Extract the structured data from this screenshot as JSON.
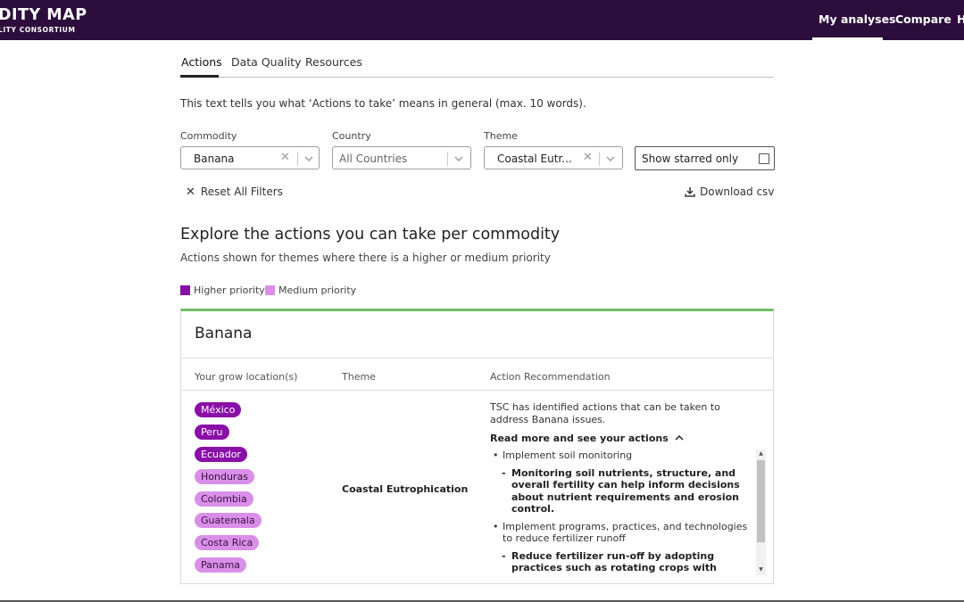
{
  "header": {
    "logo_title": "DITY MAP",
    "logo_subtitle": "LITY CONSORTIUM",
    "nav": [
      "My analyses",
      "Compare",
      "H"
    ],
    "active_nav": "My analyses"
  },
  "tabs": [
    "Actions",
    "Data Quality",
    "Resources"
  ],
  "active_tab": "Actions",
  "intro_text": "This text tells you what ‘Actions to take’ means in general (max. 10 words).",
  "filters": {
    "commodity": {
      "label": "Commodity",
      "value": "Banana"
    },
    "country": {
      "label": "Country",
      "placeholder": "All Countries"
    },
    "theme": {
      "label": "Theme",
      "value": "Coastal Eutr..."
    },
    "starred": {
      "label": "Show starred only",
      "checked": false
    },
    "reset_label": "Reset All Filters",
    "download_label": "Download csv"
  },
  "section": {
    "title": "Explore the actions you can take per commodity",
    "subtitle": "Actions shown for themes where there is a higher or medium priority"
  },
  "legend": {
    "higher": {
      "label": "Higher priority",
      "color": "#8a0fa8"
    },
    "medium": {
      "label": "Medium priority",
      "color": "#d98fe8"
    }
  },
  "card": {
    "title": "Banana",
    "accent_color": "#6fbf5f",
    "columns": [
      "Your grow location(s)",
      "Theme",
      "Action Recommendation"
    ],
    "locations": [
      {
        "name": "México",
        "priority": "higher"
      },
      {
        "name": "Peru",
        "priority": "higher"
      },
      {
        "name": "Ecuador",
        "priority": "higher"
      },
      {
        "name": "Honduras",
        "priority": "medium"
      },
      {
        "name": "Colombia",
        "priority": "medium"
      },
      {
        "name": "Guatemala",
        "priority": "medium"
      },
      {
        "name": "Costa Rica",
        "priority": "medium"
      },
      {
        "name": "Panama",
        "priority": "medium"
      }
    ],
    "theme": "Coastal Eutrophication",
    "recommendation_intro": "TSC has identified actions that can be taken to address Banana issues.",
    "read_more_label": "Read more and see your actions",
    "actions": [
      {
        "title": "Implement soil monitoring",
        "details": [
          "Monitoring soil nutrients, structure, and overall fertility can help inform decisions about nutrient requirements and erosion control."
        ]
      },
      {
        "title": "Implement programs, practices, and technologies to reduce fertilizer runoff",
        "details": [
          "Reduce fertilizer run-off by adopting practices such as rotating crops with legumes, implementing cover cropping, accounting for weather prior to application, reducing tillage, and using buffer strips."
        ]
      }
    ]
  }
}
